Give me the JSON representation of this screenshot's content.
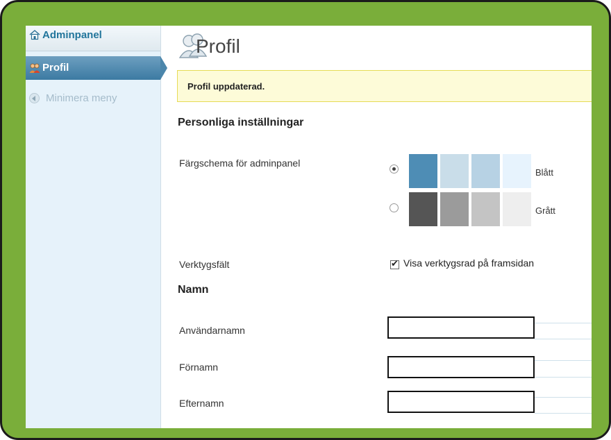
{
  "sidebar": {
    "dashboard_label": "Adminpanel",
    "dashboard_icon": "home-icon",
    "active_label": "Profil",
    "active_icon": "users-icon",
    "collapse_label": "Minimera meny",
    "collapse_icon": "collapse-arrow-icon"
  },
  "page": {
    "title": "Profil",
    "title_icon": "users-icon",
    "notice": "Profil uppdaterad."
  },
  "personal": {
    "heading": "Personliga inställningar",
    "color_scheme_label": "Färgschema för adminpanel",
    "schemes": [
      {
        "name": "Blått",
        "selected": true,
        "colors": [
          "#4e8db5",
          "#c9dde9",
          "#b7d2e4",
          "#e7f3fd"
        ]
      },
      {
        "name": "Grått",
        "selected": false,
        "colors": [
          "#555555",
          "#9b9b9b",
          "#c4c4c4",
          "#eeeeee"
        ]
      }
    ],
    "toolbar_label": "Verktygsfält",
    "toolbar_checkbox_label": "Visa verktygsrad på framsidan",
    "toolbar_checked": true
  },
  "name": {
    "heading": "Namn",
    "fields": [
      {
        "label": "Användarnamn",
        "value": ""
      },
      {
        "label": "Förnamn",
        "value": ""
      },
      {
        "label": "Efternamn",
        "value": ""
      }
    ]
  },
  "colors": {
    "frame": "#7aae3a",
    "sidebar_bg": "#e6f2fa",
    "active_item": "#4b86ab",
    "notice_bg": "#fdfbd8",
    "notice_border": "#e6db55"
  }
}
